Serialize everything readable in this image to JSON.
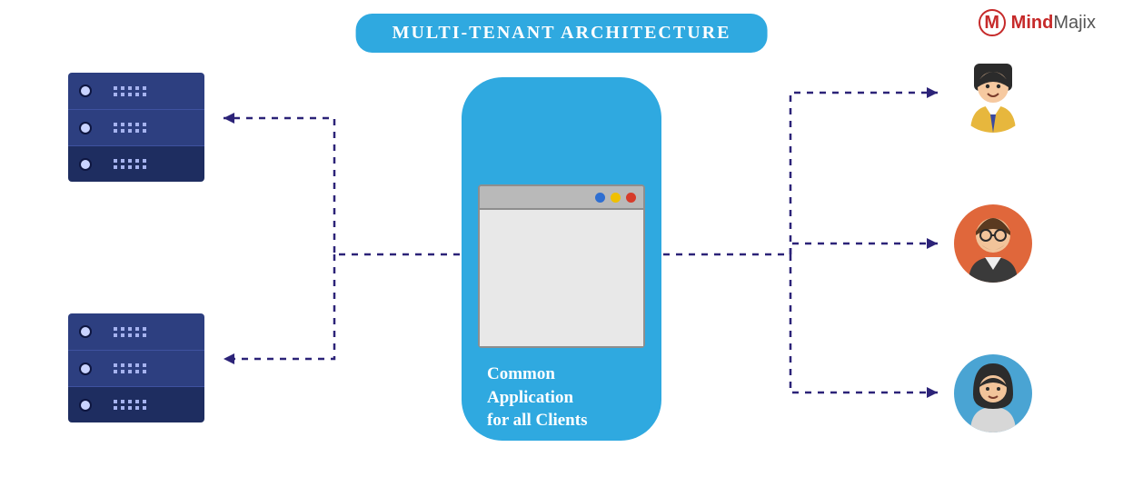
{
  "title": "MULTI-TENANT ARCHITECTURE",
  "brand_name": "MindMajix",
  "brand_initial": "M",
  "device_caption": "Common\nApplication\nfor all Clients",
  "colors": {
    "primary": "#2fa9e0",
    "server": "#2d3f80",
    "line": "#2c2378",
    "brand": "#c62a2a"
  },
  "servers": [
    "server-stack-1",
    "server-stack-2"
  ],
  "clients": [
    "client-avatar-1",
    "client-avatar-2",
    "client-avatar-3"
  ]
}
